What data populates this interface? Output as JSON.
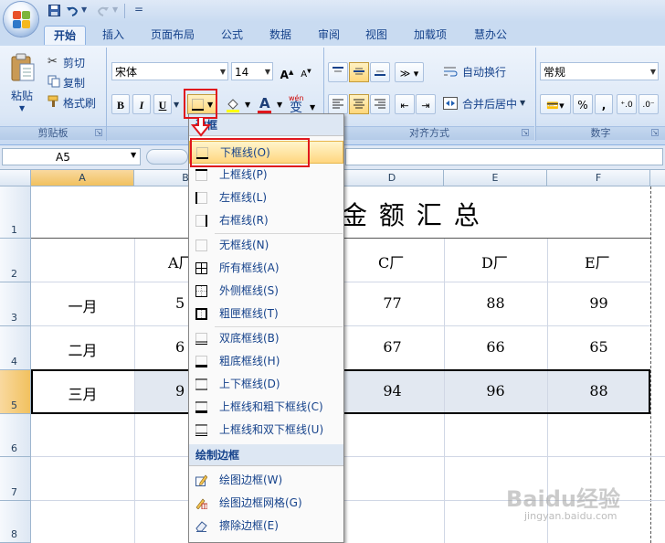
{
  "quick_access": {
    "separator_glyph": "="
  },
  "tabs": [
    {
      "label": "开始",
      "active": true
    },
    {
      "label": "插入"
    },
    {
      "label": "页面布局"
    },
    {
      "label": "公式"
    },
    {
      "label": "数据"
    },
    {
      "label": "审阅"
    },
    {
      "label": "视图"
    },
    {
      "label": "加载项"
    },
    {
      "label": "慧办公"
    }
  ],
  "clipboard": {
    "paste": "粘贴",
    "cut": "剪切",
    "copy": "复制",
    "format_painter": "格式刷",
    "group": "剪贴板"
  },
  "font": {
    "name": "宋体",
    "size": "14",
    "bold": "B",
    "italic": "I",
    "underline": "U",
    "font_color_letter": "A",
    "phonetic_top": "wén",
    "phonetic_char": "变"
  },
  "alignment": {
    "wrap_text": "自动换行",
    "merge_center": "合并后居中",
    "group": "对齐方式"
  },
  "number": {
    "format": "常规",
    "percent": "%",
    "comma": ",",
    "group": "数字"
  },
  "formula_bar": {
    "name_box": "A5"
  },
  "columns": [
    "A",
    "B",
    "C",
    "D",
    "E",
    "F"
  ],
  "rows": [
    "1",
    "2",
    "3",
    "4",
    "5",
    "6",
    "7",
    "8"
  ],
  "sheet": {
    "title": "金 额 汇 总",
    "headers": [
      "A厂",
      "C厂",
      "D厂",
      "E厂"
    ],
    "row3": {
      "label": "一月",
      "b": "5",
      "d": "77",
      "e": "88",
      "f": "99"
    },
    "row4": {
      "label": "二月",
      "b": "6",
      "d": "67",
      "e": "66",
      "f": "65"
    },
    "row5": {
      "label": "三月",
      "b": "9",
      "d": "94",
      "e": "96",
      "f": "88"
    }
  },
  "menu": {
    "header": "边框",
    "draw_header": "绘制边框",
    "items": [
      "下框线(O)",
      "上框线(P)",
      "左框线(L)",
      "右框线(R)",
      "无框线(N)",
      "所有框线(A)",
      "外侧框线(S)",
      "粗匣框线(T)",
      "双底框线(B)",
      "粗底框线(H)",
      "上下框线(D)",
      "上框线和粗下框线(C)",
      "上框线和双下框线(U)"
    ],
    "draw_items": [
      "绘图边框(W)",
      "绘图边框网格(G)",
      "擦除边框(E)"
    ]
  },
  "watermark": {
    "brand": "Baidu经验",
    "url": "jingyan.baidu.com"
  },
  "colors": {
    "highlight_red": "#e0171d",
    "ribbon_blue": "#dbe7f6",
    "selection": "#e2e8f1"
  }
}
